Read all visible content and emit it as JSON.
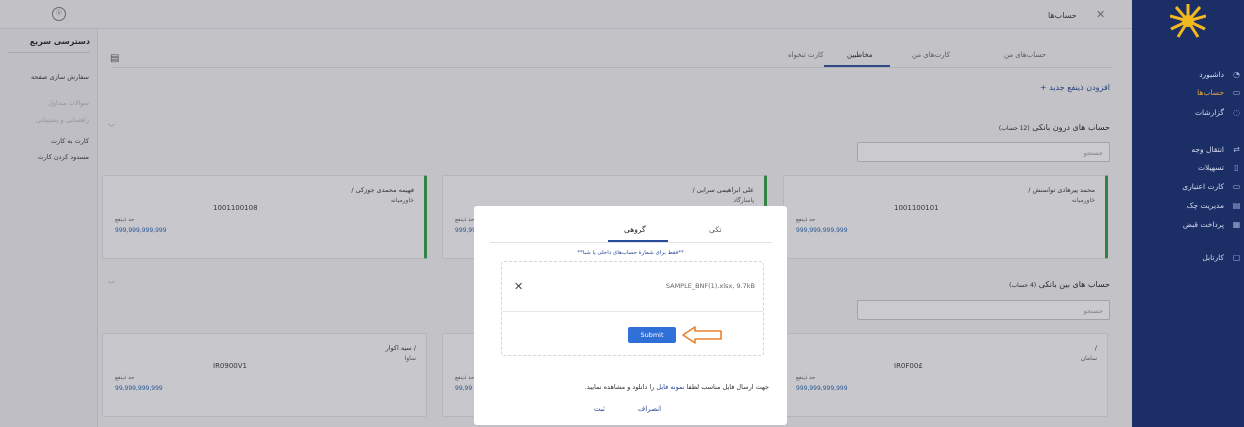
{
  "header": {
    "title": "حساب‌ها",
    "close_glyph": "✕"
  },
  "sidebar": {
    "items": [
      {
        "label": "داشبورد",
        "active": false
      },
      {
        "label": "حساب‌ها",
        "active": true
      },
      {
        "label": "گزارشات",
        "active": false
      },
      {
        "label": "انتقال وجه",
        "active": false
      },
      {
        "label": "تسهیلات",
        "active": false
      },
      {
        "label": "کارت اعتباری",
        "active": false
      },
      {
        "label": "مدیریت چک",
        "active": false
      },
      {
        "label": "پرداخت قبض",
        "active": false
      },
      {
        "label": "کارتابل",
        "active": false
      }
    ]
  },
  "quick_access": {
    "title": "دسترسی سریع",
    "items": [
      {
        "label": "سفارش سازی صفحه",
        "enabled": true
      },
      {
        "label": "سوالات متداول",
        "enabled": false
      },
      {
        "label": "راهنمایی و پشتیبانی",
        "enabled": false
      },
      {
        "label": "کارت به کارت",
        "enabled": true
      },
      {
        "label": "مسدود کردن کارت",
        "enabled": true
      }
    ]
  },
  "tabs": [
    {
      "label": "حساب‌های من",
      "active": false
    },
    {
      "label": "کارت‌های من",
      "active": false
    },
    {
      "label": "مخاطبین",
      "active": true
    },
    {
      "label": "کارت تنخواه",
      "active": false
    }
  ],
  "add_beneficiary": "افزودن ذینفع جدید +",
  "internal": {
    "title": "حساب های درون بانکی",
    "count": "(12 حساب)",
    "search_placeholder": "جستجو",
    "cards": [
      {
        "name": "محمد پیرهادی توانمنش /",
        "sub": "خاورمیانه",
        "acct": "1001100101",
        "limit_label": "حد ذینفع",
        "limit": "999,999,999,999"
      },
      {
        "name": "علی ابراهیمی سرابی /",
        "sub": "پاسارگاد",
        "acct": "",
        "limit_label": "حد ذینفع",
        "limit": "999,999,999,999"
      },
      {
        "name": "فهیمه محمدی جوزکی /",
        "sub": "خاورمیانه",
        "acct": "1001100108",
        "limit_label": "حد ذینفع",
        "limit": "999,999,999,999"
      }
    ]
  },
  "external": {
    "title": "حساب های بین بانکی",
    "count": "(4 حساب)",
    "search_placeholder": "جستجو",
    "cards": [
      {
        "name": "/",
        "sub": "سامان",
        "acct": "IR0F00£",
        "limit_label": "حد ذینفع",
        "limit": "999,999,999,999"
      },
      {
        "name": "",
        "sub": "",
        "acct": "",
        "limit_label": "حد ذینفع",
        "limit": "99,99"
      },
      {
        "name": "/ سیه اکوار",
        "sub": "ساوا",
        "acct": "IR0900V1",
        "limit_label": "حد ذینفع",
        "limit": "99,999,999,999"
      }
    ]
  },
  "modal": {
    "tab_single": "تکی",
    "tab_group": "گروهی",
    "note": "**فقط برای شمارهٔ حساب‌های داخلی یا شبا**",
    "file_name": "SAMPLE_BNF(1).xlsx, 9.7kB",
    "remove_glyph": "✕",
    "submit_label": "Submit",
    "hint_before": "جهت ارسال فایل مناسب لطفا ",
    "hint_link": "نمونه فایل",
    "hint_after": " را دانلود و مشاهده نمایید.",
    "cancel_label": "انصراف",
    "confirm_label": "ثبت"
  },
  "colors": {
    "sidebar": "#1b2f66",
    "accent": "#2a4b9a",
    "submit": "#2f6fd8",
    "card_border": "#2d9b45",
    "arrow": "#e9822e"
  }
}
